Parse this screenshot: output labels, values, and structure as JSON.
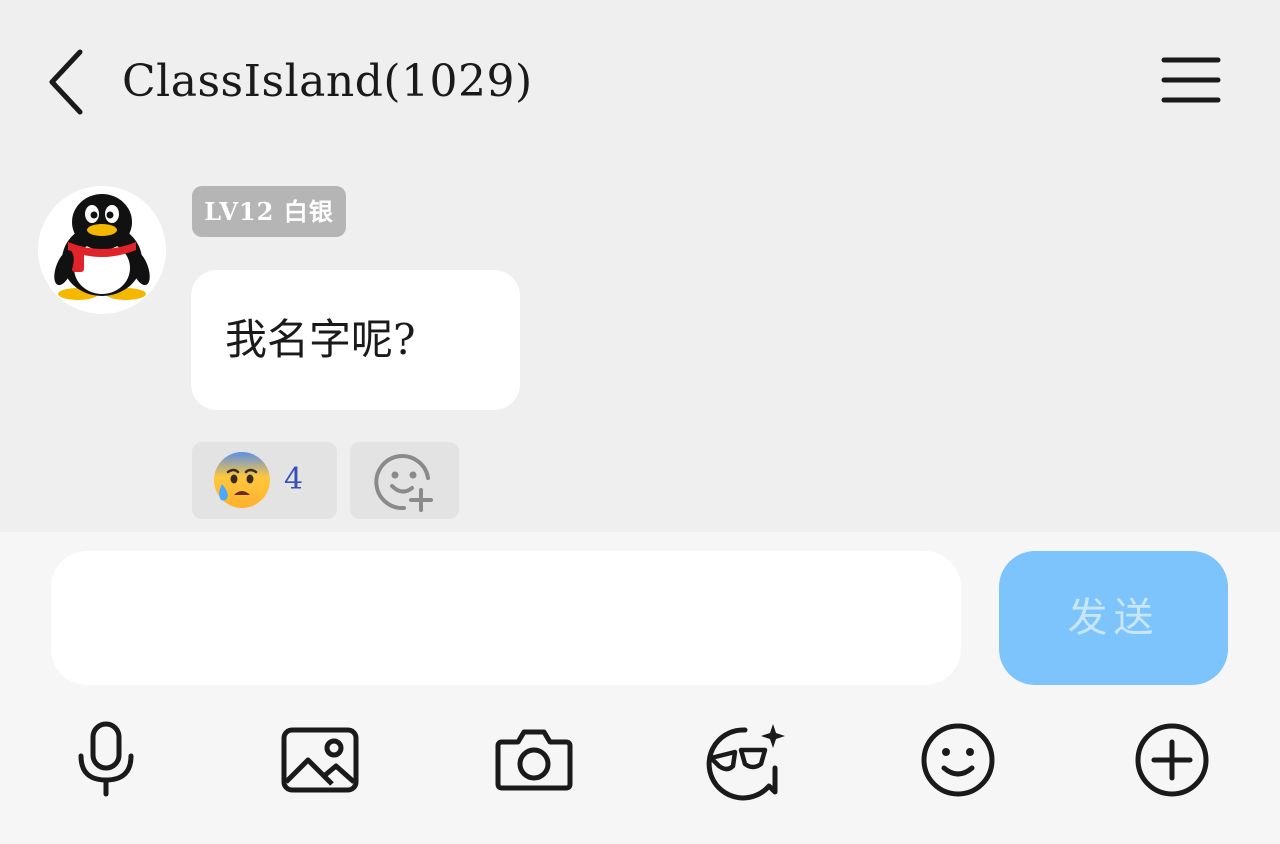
{
  "header": {
    "title": "ClassIsland(1029)",
    "back_icon": "chevron-left-icon",
    "menu_icon": "hamburger-menu-icon"
  },
  "message": {
    "avatar_icon": "qq-penguin-avatar-icon",
    "level_badge": "LV12 白银",
    "text": "我名字呢?",
    "reactions": [
      {
        "emoji_icon": "anxious-face-with-sweat-icon",
        "count": "4"
      }
    ],
    "add_reaction_icon": "add-emoji-reaction-icon"
  },
  "composer": {
    "input_value": "",
    "send_label": "发送"
  },
  "toolbar": {
    "icons": [
      "microphone-icon",
      "image-icon",
      "camera-icon",
      "sticker-face-icon",
      "smiley-face-icon",
      "plus-circle-icon"
    ]
  },
  "colors": {
    "background": "#efefef",
    "send_button": "#7cc4fb",
    "reaction_count": "#3550b8",
    "badge": "#b5b5b5"
  }
}
